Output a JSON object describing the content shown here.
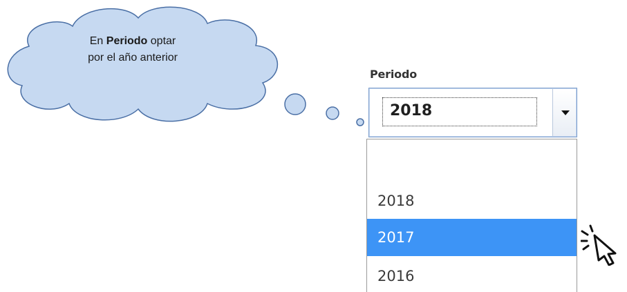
{
  "callout": {
    "line1_prefix": "En ",
    "line1_bold": "Periodo",
    "line1_suffix": " optar",
    "line2": "por el año anterior",
    "fill_color": "#c6d9f1",
    "stroke_color": "#4a6fa5"
  },
  "period_select": {
    "label": "Periodo",
    "selected_value": "2018",
    "options": [
      "",
      "2018",
      "2017",
      "2016"
    ],
    "highlighted_option": "2017",
    "highlight_color": "#3d94f6"
  },
  "icons": {
    "dropdown_arrow": "chevron-down-icon",
    "pointer": "click-cursor-icon"
  }
}
